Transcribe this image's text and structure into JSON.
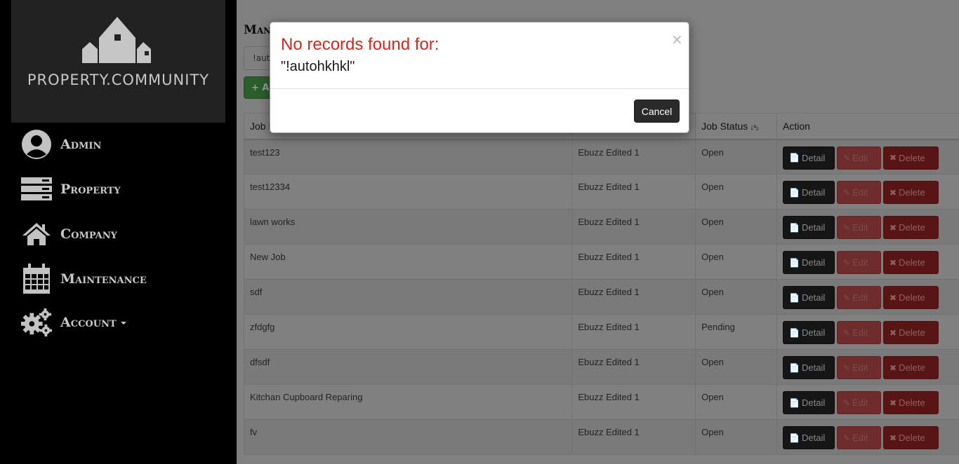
{
  "app": {
    "brand": "PROPERTY.COMMUNITY"
  },
  "sidebar": {
    "items": [
      {
        "label": "Admin",
        "icon": "user-circle-icon"
      },
      {
        "label": "Property",
        "icon": "server-stack-icon"
      },
      {
        "label": "Company",
        "icon": "home-icon"
      },
      {
        "label": "Maintenance",
        "icon": "calendar-icon"
      },
      {
        "label": "Account",
        "icon": "gears-icon",
        "has_dropdown": true
      }
    ]
  },
  "main": {
    "title_visible": "Man",
    "search_value": "!aut",
    "add_button_label": "+ A",
    "table": {
      "headers": [
        "Job D",
        "",
        "Job Status",
        "Action"
      ],
      "rows": [
        {
          "desc": "test123",
          "company": "Ebuzz Edited 1",
          "status": "Open"
        },
        {
          "desc": "test12334",
          "company": "Ebuzz Edited 1",
          "status": "Open"
        },
        {
          "desc": "lawn works",
          "company": "Ebuzz Edited 1",
          "status": "Open"
        },
        {
          "desc": "New Job",
          "company": "Ebuzz Edited 1",
          "status": "Open"
        },
        {
          "desc": "sdf",
          "company": "Ebuzz Edited 1",
          "status": "Open"
        },
        {
          "desc": "zfdgfg",
          "company": "Ebuzz Edited 1",
          "status": "Pending"
        },
        {
          "desc": "dfsdf",
          "company": "Ebuzz Edited 1",
          "status": "Open"
        },
        {
          "desc": "Kitchan Cupboard Reparing",
          "company": "Ebuzz Edited 1",
          "status": "Open"
        },
        {
          "desc": "fv",
          "company": "Ebuzz Edited 1",
          "status": "Open"
        }
      ],
      "actions": {
        "detail": "Detail",
        "edit": "Edit",
        "delete": "Delete"
      }
    }
  },
  "modal": {
    "title": "No records found for:",
    "query": "\"!autohkhkl\"",
    "close_symbol": "×",
    "cancel_label": "Cancel"
  },
  "colors": {
    "accent_red": "#d9261c",
    "sidebar_bg": "#000000",
    "logo_bg": "#222222"
  }
}
